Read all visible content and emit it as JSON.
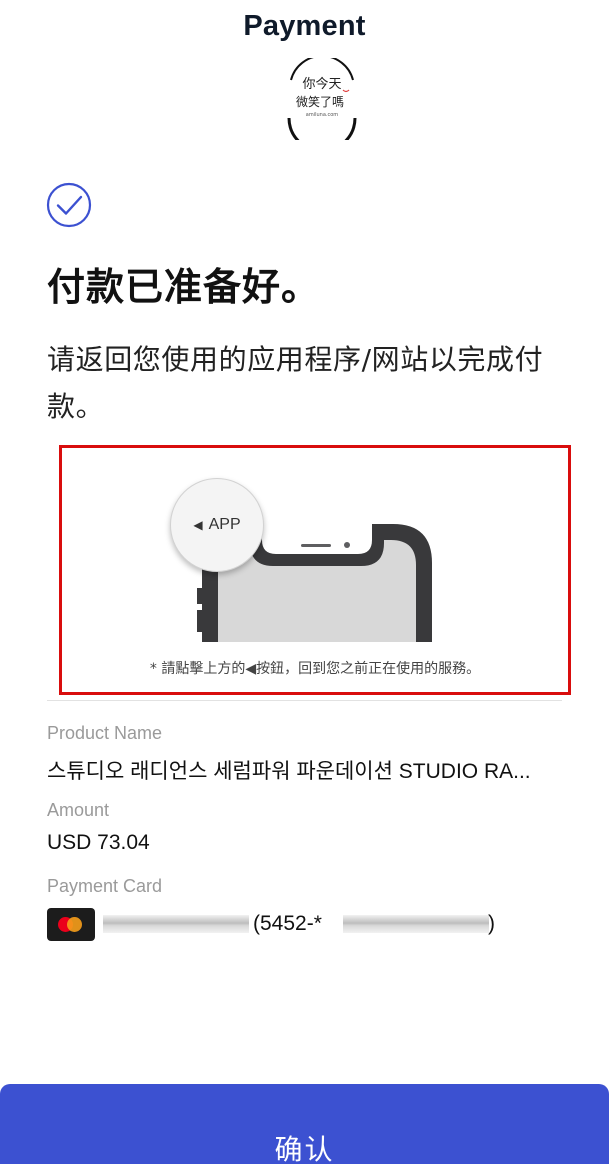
{
  "header": {
    "title": "Payment"
  },
  "watermark": {
    "line1": "你今天",
    "line2": "微笑了嗎",
    "line3": "amiluna.com"
  },
  "status": {
    "icon": "check-circle-icon",
    "heading": "付款已准备好。",
    "message": "请返回您使用的应用程序/网站以完成付款。"
  },
  "illustration": {
    "app_label": "APP",
    "caption": "* 請點擊上方的◀按鈕，回到您之前正在使用的服務。",
    "highlight_color": "#d90d0d"
  },
  "details": {
    "product": {
      "label": "Product Name",
      "value": "스튜디오 래디언스 세럼파워 파운데이션 STUDIO RA..."
    },
    "amount": {
      "label": "Amount",
      "value": "USD 73.04"
    },
    "card": {
      "label": "Payment Card",
      "icon": "mastercard-icon",
      "number_prefix": "(5452-*",
      "number_suffix": ")"
    }
  },
  "actions": {
    "confirm_label": "确认",
    "accent_color": "#3c51d1"
  }
}
